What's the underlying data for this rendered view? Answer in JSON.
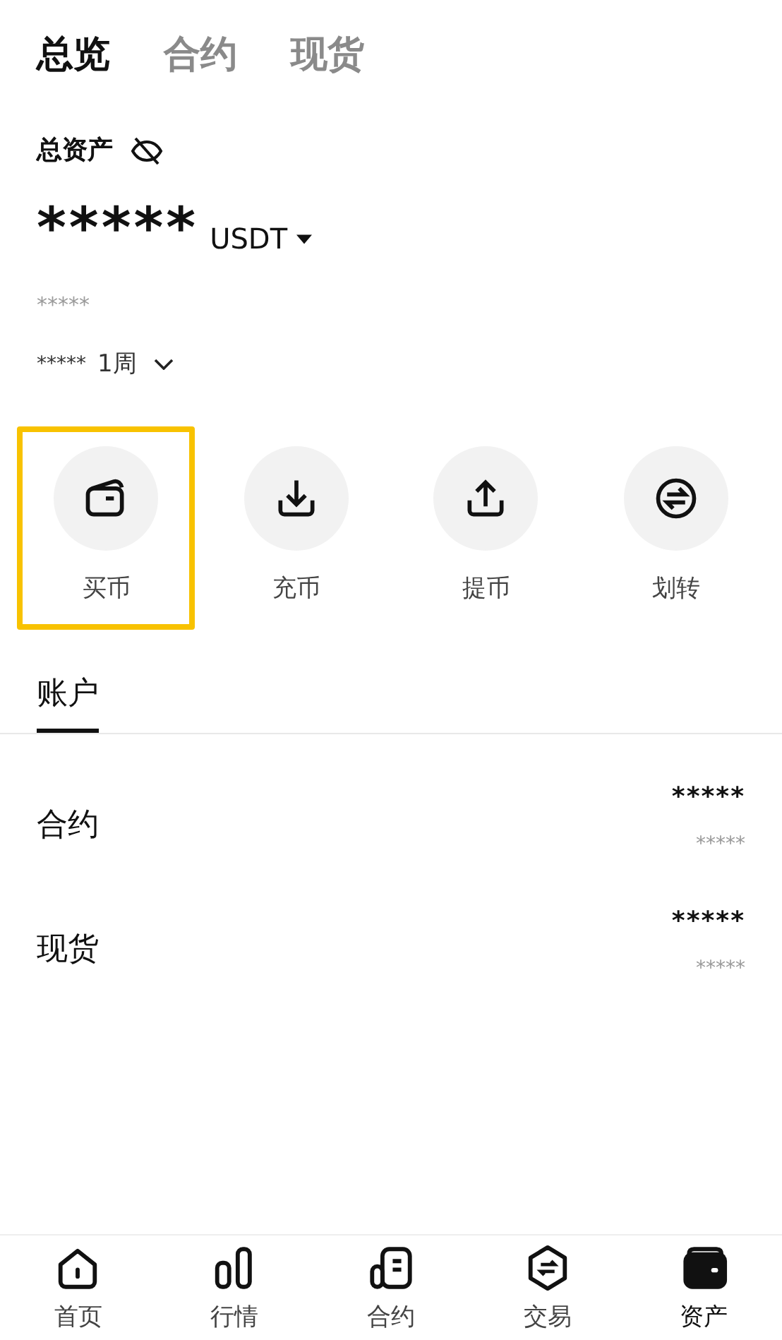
{
  "tabs": [
    {
      "label": "总览",
      "selected": true
    },
    {
      "label": "合约",
      "selected": false
    },
    {
      "label": "现货",
      "selected": false
    }
  ],
  "assets": {
    "title": "总资产",
    "hidden": true,
    "total": "*****",
    "currency": "USDT",
    "equivalent": "*****",
    "change": "*****",
    "period": "1周"
  },
  "actions": [
    {
      "label": "买币",
      "kind": "wallet",
      "highlighted": true
    },
    {
      "label": "充币",
      "kind": "deposit",
      "highlighted": false
    },
    {
      "label": "提币",
      "kind": "withdraw",
      "highlighted": false
    },
    {
      "label": "划转",
      "kind": "transfer",
      "highlighted": false
    }
  ],
  "account_tabs": [
    {
      "label": "账户",
      "selected": true
    }
  ],
  "accounts": [
    {
      "name": "合约",
      "value": "*****",
      "sub_value": "*****"
    },
    {
      "name": "现货",
      "value": "*****",
      "sub_value": "*****"
    }
  ],
  "nav": [
    {
      "label": "首页",
      "kind": "home",
      "selected": false
    },
    {
      "label": "行情",
      "kind": "market",
      "selected": false
    },
    {
      "label": "合约",
      "kind": "contract",
      "selected": false
    },
    {
      "label": "交易",
      "kind": "trade",
      "selected": false
    },
    {
      "label": "资产",
      "kind": "assets",
      "selected": true
    }
  ]
}
